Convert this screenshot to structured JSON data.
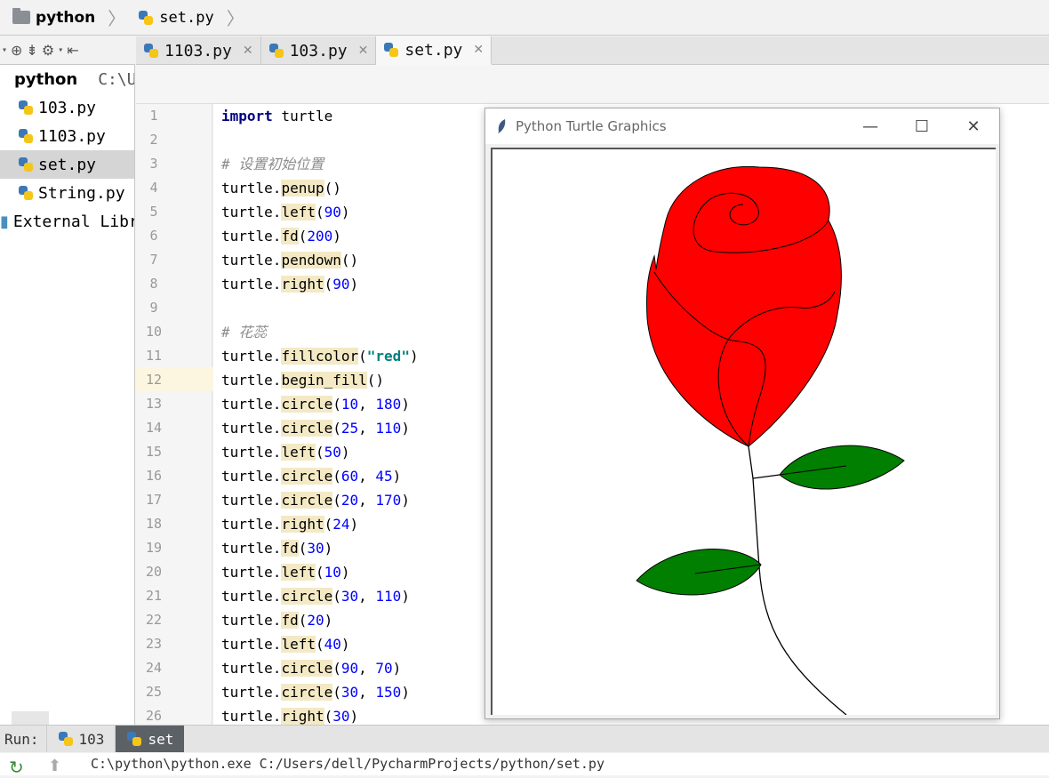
{
  "breadcrumb": {
    "project": "python",
    "file": "set.py"
  },
  "tabs": [
    {
      "label": "1103.py",
      "active": false
    },
    {
      "label": "103.py",
      "active": false
    },
    {
      "label": "set.py",
      "active": true
    }
  ],
  "sidebar": {
    "root_label": "python",
    "root_path": "C:\\Us",
    "items": [
      {
        "label": "103.py"
      },
      {
        "label": "1103.py"
      },
      {
        "label": "set.py",
        "selected": true
      },
      {
        "label": "String.py"
      }
    ],
    "external": "External Libr"
  },
  "code_lines": [
    {
      "n": "1",
      "segs": [
        [
          "kw",
          "import"
        ],
        [
          "t",
          " turtle"
        ]
      ]
    },
    {
      "n": "2",
      "segs": []
    },
    {
      "n": "3",
      "segs": [
        [
          "cmt",
          "# 设置初始位置"
        ]
      ]
    },
    {
      "n": "4",
      "segs": [
        [
          "t",
          "turtle."
        ],
        [
          "fn",
          "penup"
        ],
        [
          "t",
          "()"
        ]
      ]
    },
    {
      "n": "5",
      "segs": [
        [
          "t",
          "turtle."
        ],
        [
          "fn",
          "left"
        ],
        [
          "t",
          "("
        ],
        [
          "num",
          "90"
        ],
        [
          "t",
          ")"
        ]
      ]
    },
    {
      "n": "6",
      "segs": [
        [
          "t",
          "turtle."
        ],
        [
          "fn",
          "fd"
        ],
        [
          "t",
          "("
        ],
        [
          "num",
          "200"
        ],
        [
          "t",
          ")"
        ]
      ]
    },
    {
      "n": "7",
      "segs": [
        [
          "t",
          "turtle."
        ],
        [
          "fn",
          "pendown"
        ],
        [
          "t",
          "()"
        ]
      ]
    },
    {
      "n": "8",
      "segs": [
        [
          "t",
          "turtle."
        ],
        [
          "fn",
          "right"
        ],
        [
          "t",
          "("
        ],
        [
          "num",
          "90"
        ],
        [
          "t",
          ")"
        ]
      ]
    },
    {
      "n": "9",
      "segs": []
    },
    {
      "n": "10",
      "segs": [
        [
          "cmt",
          "# 花蕊"
        ]
      ]
    },
    {
      "n": "11",
      "segs": [
        [
          "t",
          "turtle."
        ],
        [
          "fn",
          "fillcolor"
        ],
        [
          "t",
          "("
        ],
        [
          "str",
          "\"red\""
        ],
        [
          "t",
          ")"
        ]
      ]
    },
    {
      "n": "12",
      "segs": [
        [
          "t",
          "turtle."
        ],
        [
          "fn",
          "begin_fill"
        ],
        [
          "t",
          "()"
        ]
      ]
    },
    {
      "n": "13",
      "segs": [
        [
          "t",
          "turtle."
        ],
        [
          "fn",
          "circle"
        ],
        [
          "t",
          "("
        ],
        [
          "num",
          "10"
        ],
        [
          "t",
          ", "
        ],
        [
          "num",
          "180"
        ],
        [
          "t",
          ")"
        ]
      ]
    },
    {
      "n": "14",
      "segs": [
        [
          "t",
          "turtle."
        ],
        [
          "fn",
          "circle"
        ],
        [
          "t",
          "("
        ],
        [
          "num",
          "25"
        ],
        [
          "t",
          ", "
        ],
        [
          "num",
          "110"
        ],
        [
          "t",
          ")"
        ]
      ]
    },
    {
      "n": "15",
      "segs": [
        [
          "t",
          "turtle."
        ],
        [
          "fn",
          "left"
        ],
        [
          "t",
          "("
        ],
        [
          "num",
          "50"
        ],
        [
          "t",
          ")"
        ]
      ]
    },
    {
      "n": "16",
      "segs": [
        [
          "t",
          "turtle."
        ],
        [
          "fn",
          "circle"
        ],
        [
          "t",
          "("
        ],
        [
          "num",
          "60"
        ],
        [
          "t",
          ", "
        ],
        [
          "num",
          "45"
        ],
        [
          "t",
          ")"
        ]
      ]
    },
    {
      "n": "17",
      "segs": [
        [
          "t",
          "turtle."
        ],
        [
          "fn",
          "circle"
        ],
        [
          "t",
          "("
        ],
        [
          "num",
          "20"
        ],
        [
          "t",
          ", "
        ],
        [
          "num",
          "170"
        ],
        [
          "t",
          ")"
        ]
      ]
    },
    {
      "n": "18",
      "segs": [
        [
          "t",
          "turtle."
        ],
        [
          "fn",
          "right"
        ],
        [
          "t",
          "("
        ],
        [
          "num",
          "24"
        ],
        [
          "t",
          ")"
        ]
      ]
    },
    {
      "n": "19",
      "segs": [
        [
          "t",
          "turtle."
        ],
        [
          "fn",
          "fd"
        ],
        [
          "t",
          "("
        ],
        [
          "num",
          "30"
        ],
        [
          "t",
          ")"
        ]
      ]
    },
    {
      "n": "20",
      "segs": [
        [
          "t",
          "turtle."
        ],
        [
          "fn",
          "left"
        ],
        [
          "t",
          "("
        ],
        [
          "num",
          "10"
        ],
        [
          "t",
          ")"
        ]
      ]
    },
    {
      "n": "21",
      "segs": [
        [
          "t",
          "turtle."
        ],
        [
          "fn",
          "circle"
        ],
        [
          "t",
          "("
        ],
        [
          "num",
          "30"
        ],
        [
          "t",
          ", "
        ],
        [
          "num",
          "110"
        ],
        [
          "t",
          ")"
        ]
      ]
    },
    {
      "n": "22",
      "segs": [
        [
          "t",
          "turtle."
        ],
        [
          "fn",
          "fd"
        ],
        [
          "t",
          "("
        ],
        [
          "num",
          "20"
        ],
        [
          "t",
          ")"
        ]
      ]
    },
    {
      "n": "23",
      "segs": [
        [
          "t",
          "turtle."
        ],
        [
          "fn",
          "left"
        ],
        [
          "t",
          "("
        ],
        [
          "num",
          "40"
        ],
        [
          "t",
          ")"
        ]
      ]
    },
    {
      "n": "24",
      "segs": [
        [
          "t",
          "turtle."
        ],
        [
          "fn",
          "circle"
        ],
        [
          "t",
          "("
        ],
        [
          "num",
          "90"
        ],
        [
          "t",
          ", "
        ],
        [
          "num",
          "70"
        ],
        [
          "t",
          ")"
        ]
      ]
    },
    {
      "n": "25",
      "segs": [
        [
          "t",
          "turtle."
        ],
        [
          "fn",
          "circle"
        ],
        [
          "t",
          "("
        ],
        [
          "num",
          "30"
        ],
        [
          "t",
          ", "
        ],
        [
          "num",
          "150"
        ],
        [
          "t",
          ")"
        ]
      ]
    },
    {
      "n": "26",
      "segs": [
        [
          "t",
          "turtle."
        ],
        [
          "fn",
          "right"
        ],
        [
          "t",
          "("
        ],
        [
          "num",
          "30"
        ],
        [
          "t",
          ")"
        ]
      ]
    }
  ],
  "highlighted_line": "12",
  "turtle_window": {
    "title": "Python Turtle Graphics",
    "minimize": "—",
    "maximize": "☐",
    "close": "✕",
    "colors": {
      "petal": "#ff0000",
      "leaf": "#007f00",
      "stroke": "#000000"
    }
  },
  "run": {
    "label": "Run:",
    "tabs": [
      {
        "label": "103",
        "active": false
      },
      {
        "label": "set",
        "active": true
      }
    ],
    "command": "C:\\python\\python.exe C:/Users/dell/PycharmProjects/python/set.py"
  }
}
